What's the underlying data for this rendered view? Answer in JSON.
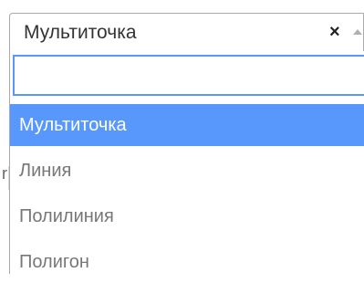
{
  "select": {
    "selected_value": "Мультиточка",
    "clear_glyph": "×",
    "arrow_icon": "caret-up-icon"
  },
  "search": {
    "value": "",
    "placeholder": ""
  },
  "options": [
    {
      "label": "Мультиточка",
      "highlighted": true
    },
    {
      "label": "Линия",
      "highlighted": false
    },
    {
      "label": "Полилиния",
      "highlighted": false
    },
    {
      "label": "Полигон",
      "highlighted": false
    }
  ],
  "colors": {
    "highlight": "#5897fb",
    "option_text": "#777777",
    "border": "#aaaaaa"
  }
}
